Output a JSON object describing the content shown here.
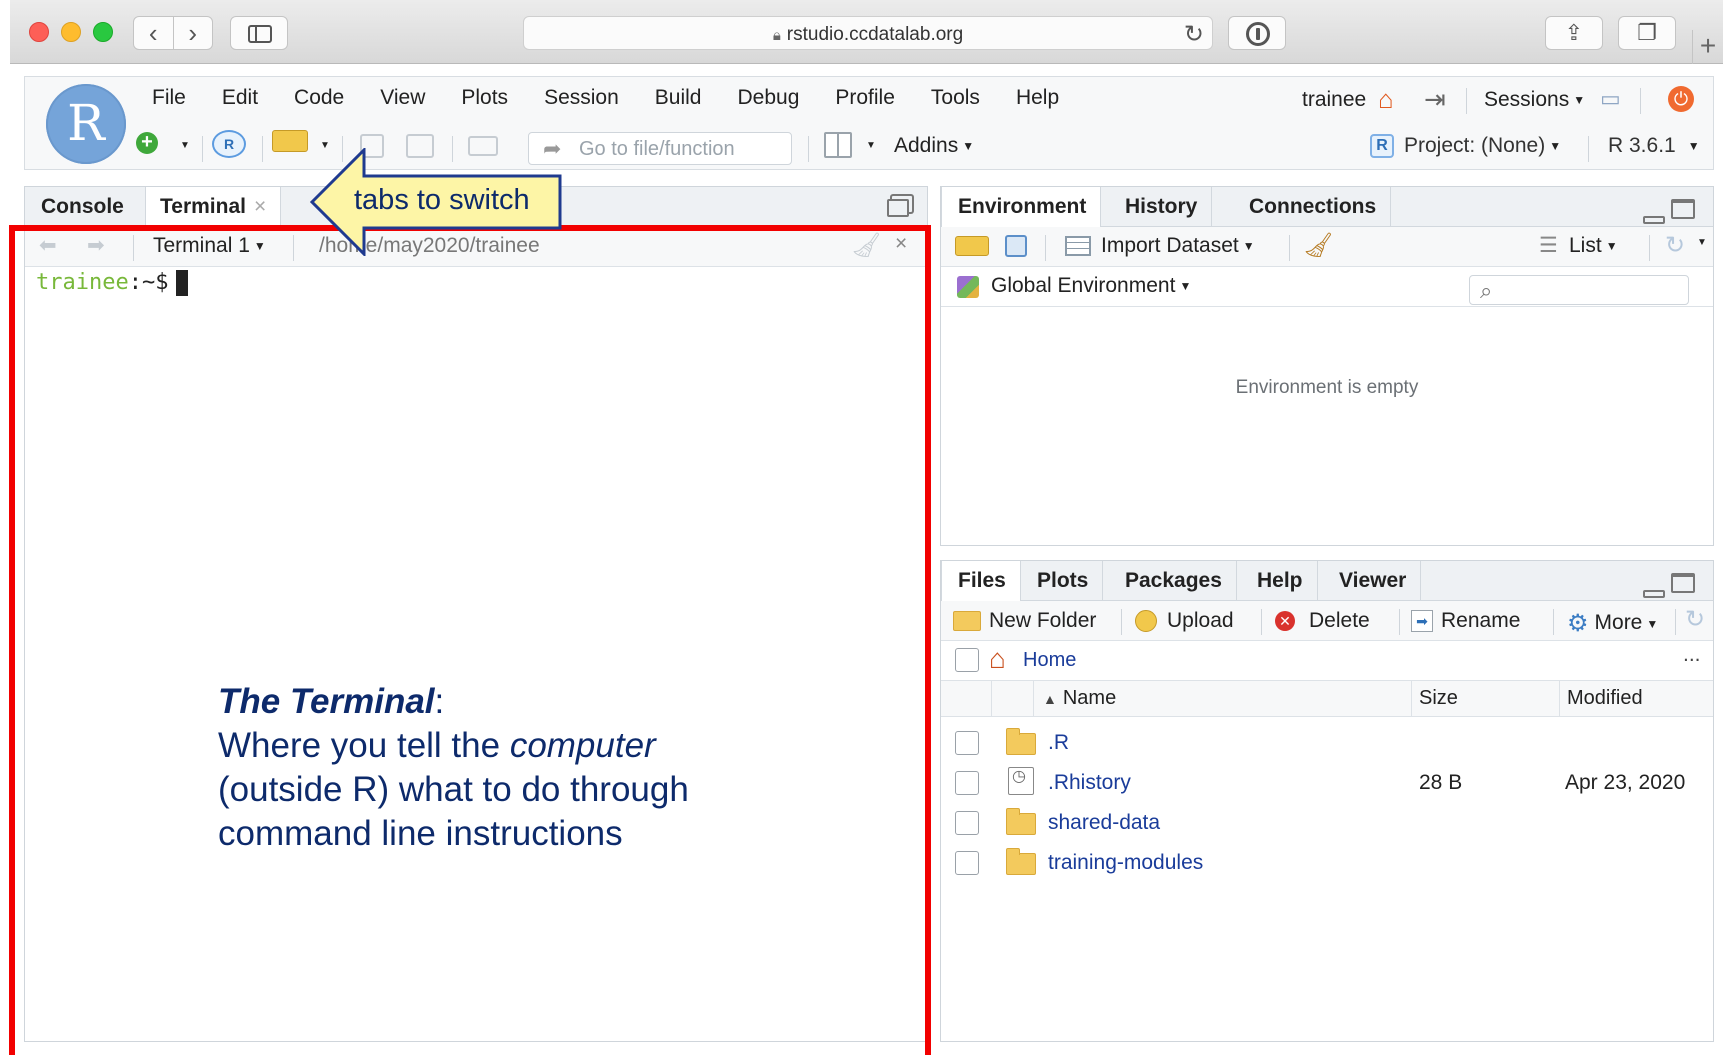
{
  "browser": {
    "url": "rstudio.ccdatalab.org"
  },
  "rstudio": {
    "logo_letter": "R",
    "menu": [
      "File",
      "Edit",
      "Code",
      "View",
      "Plots",
      "Session",
      "Build",
      "Debug",
      "Profile",
      "Tools",
      "Help"
    ],
    "user": "trainee",
    "sessions_label": "Sessions",
    "goto_placeholder": "Go to file/function",
    "addins_label": "Addins",
    "project_label": "Project: (None)",
    "r_version": "R 3.6.1"
  },
  "left_pane": {
    "tabs": [
      "Console",
      "Terminal"
    ],
    "active_tab": "Terminal",
    "terminal_selector": "Terminal 1",
    "path": "/home/may2020/trainee",
    "prompt_user": "trainee",
    "prompt_rest": ":~$"
  },
  "callout": {
    "text": "tabs to switch"
  },
  "annotation": {
    "title": "The Terminal",
    "colon": ":",
    "line1_pre": "Where you tell the ",
    "line1_em": "computer",
    "line2": "(outside R) what to do through",
    "line3": "command line instructions"
  },
  "env_pane": {
    "tabs": [
      "Environment",
      "History",
      "Connections"
    ],
    "import_label": "Import Dataset",
    "list_label": "List",
    "scope_label": "Global Environment",
    "empty_msg": "Environment is empty"
  },
  "files_pane": {
    "tabs": [
      "Files",
      "Plots",
      "Packages",
      "Help",
      "Viewer"
    ],
    "toolbar": {
      "new_folder": "New Folder",
      "upload": "Upload",
      "delete": "Delete",
      "rename": "Rename",
      "more": "More"
    },
    "breadcrumb": "Home",
    "more_dots": "...",
    "columns": {
      "name": "Name",
      "size": "Size",
      "modified": "Modified"
    },
    "files": [
      {
        "name": ".R",
        "size": "",
        "modified": "",
        "type": "folder"
      },
      {
        "name": ".Rhistory",
        "size": "28 B",
        "modified": "Apr 23, 2020",
        "type": "file"
      },
      {
        "name": "shared-data",
        "size": "",
        "modified": "",
        "type": "folder"
      },
      {
        "name": "training-modules",
        "size": "",
        "modified": "",
        "type": "folder"
      }
    ]
  },
  "colors": {
    "highlight_border": "#f20000",
    "annotation_text": "#0d2a6b",
    "callout_fill": "#fdf5a6",
    "callout_border": "#1f3a8f",
    "prompt_user": "#78b83a",
    "file_link": "#1a3c9a"
  }
}
